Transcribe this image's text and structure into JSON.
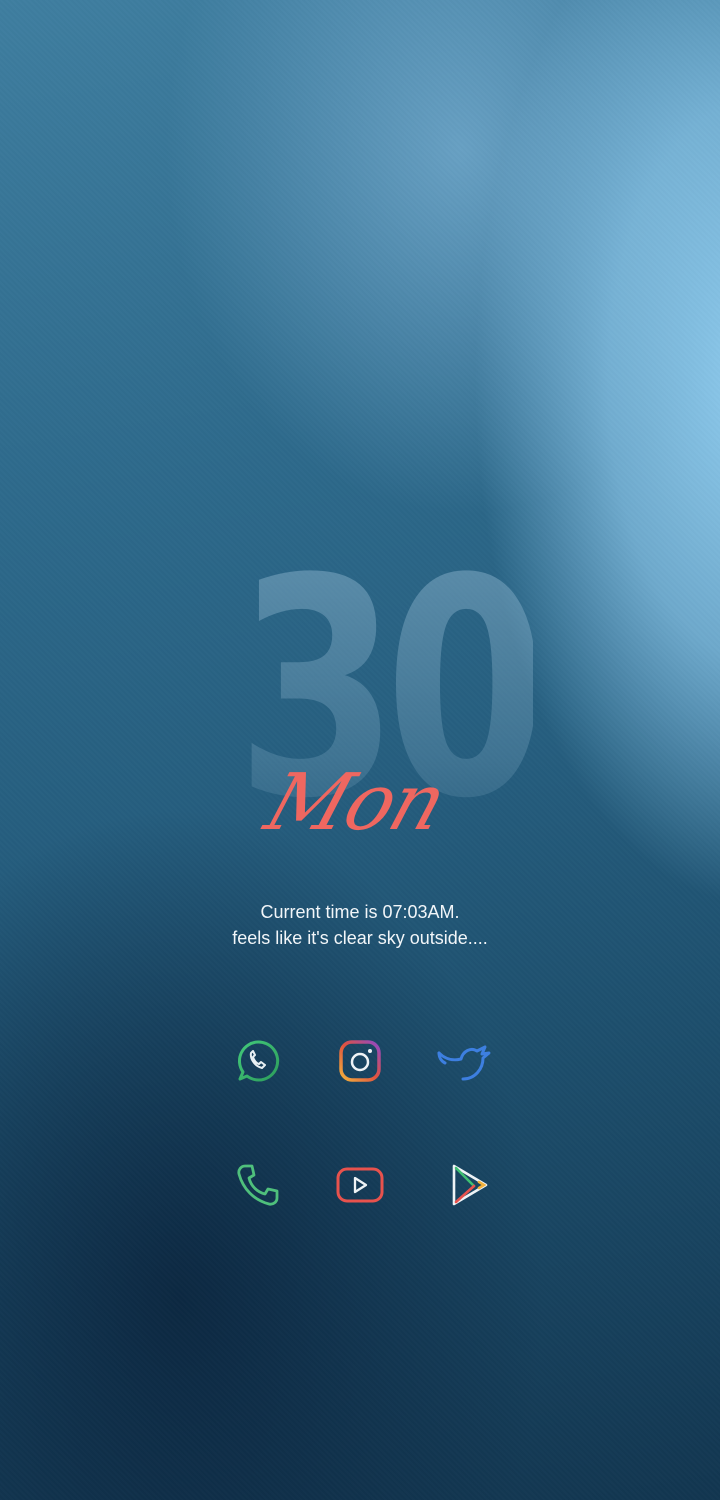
{
  "home": {
    "date_number": "30",
    "day_name": "Mon",
    "line1": "Current time is 07:03AM.",
    "line2": "feels like it's clear sky outside...."
  },
  "dock": {
    "row1": [
      "whatsapp-icon",
      "instagram-icon",
      "twitter-icon"
    ],
    "row2": [
      "phone-icon",
      "youtube-icon",
      "play-store-icon"
    ]
  },
  "colors": {
    "accent_red": "#ef6760",
    "whatsapp_green": "#3fbf72",
    "twitter_blue": "#3d7fe0",
    "text_white": "#f2f6f9"
  }
}
